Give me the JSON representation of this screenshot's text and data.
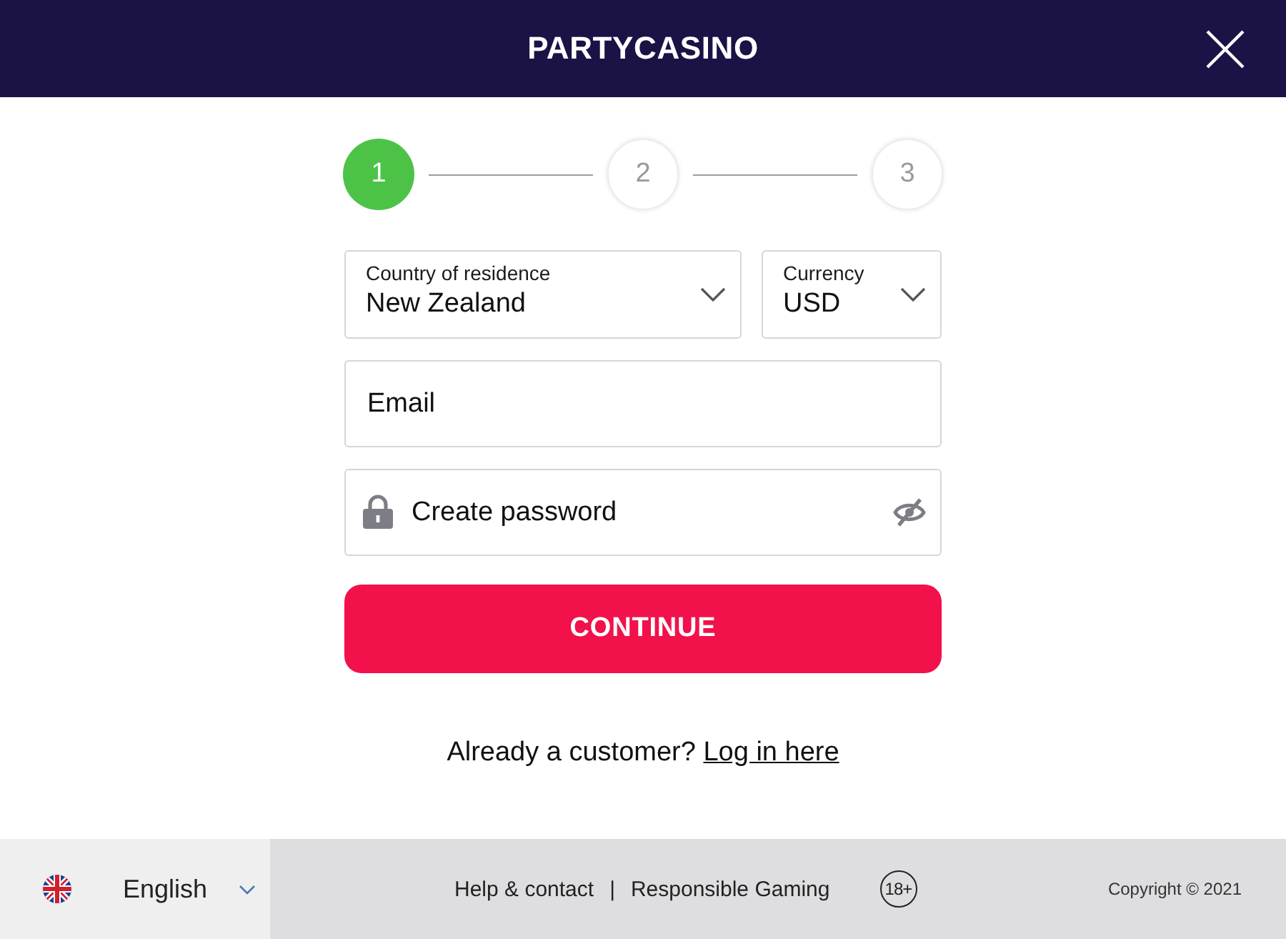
{
  "header": {
    "logo": "PARTYCASINO"
  },
  "steps": [
    {
      "label": "1",
      "selected": true
    },
    {
      "label": "2",
      "selected": false
    },
    {
      "label": "3",
      "selected": false
    }
  ],
  "selects": [
    {
      "label": "Country of residence",
      "value": "New Zealand"
    },
    {
      "label": "Currency",
      "value": "USD"
    }
  ],
  "email": {
    "placeholder": "Email"
  },
  "password": {
    "placeholder": "Create password"
  },
  "continue_button": "CONTINUE",
  "login_prompt": {
    "text": "Already a customer?",
    "link": "Log in here"
  },
  "footer": {
    "language": "English",
    "links": [
      "Help & contact",
      "Responsible Gaming"
    ],
    "separator": "|",
    "age_badge": "18+",
    "copyright": "Copyright © 2021"
  }
}
